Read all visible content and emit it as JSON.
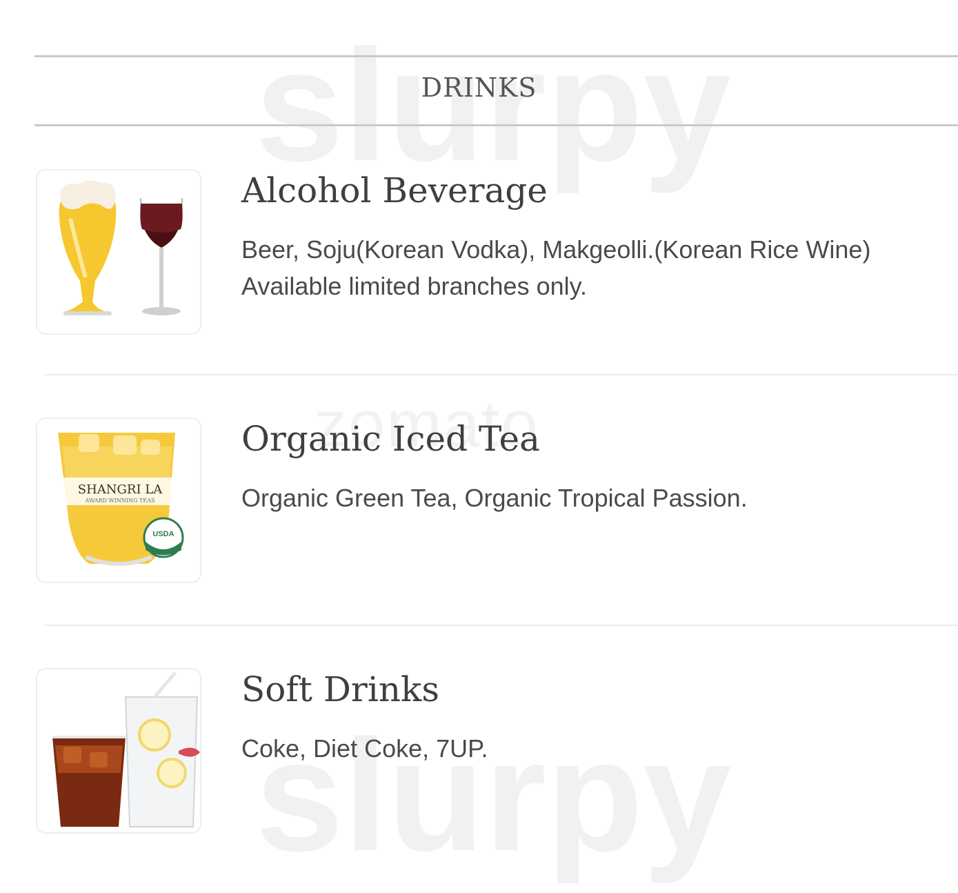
{
  "section": {
    "title": "DRINKS"
  },
  "items": [
    {
      "name": "Alcohol Beverage",
      "description": "Beer, Soju(Korean Vodka), Makgeolli.(Korean Rice Wine) Available limited branches only.",
      "image_icon": "beer-and-wine-glasses"
    },
    {
      "name": "Organic Iced Tea",
      "description": "Organic Green Tea, Organic Tropical Passion.",
      "image_icon": "iced-tea-glass",
      "image_text": {
        "brand": "SHANGRI LA",
        "tagline": "AWARD WINNING TEAS",
        "seal": "USDA ORGANIC"
      }
    },
    {
      "name": "Soft Drinks",
      "description": "Coke, Diet Coke, 7UP.",
      "image_icon": "soda-glasses"
    }
  ],
  "watermarks": {
    "top": "slurpy",
    "middle": "zomato",
    "bottom": "slurpy"
  },
  "colors": {
    "text_dark": "#3f3f3f",
    "text_desc": "#4a4a4a",
    "rule": "#c9c9c9",
    "accent_orange": "#f5a050"
  }
}
